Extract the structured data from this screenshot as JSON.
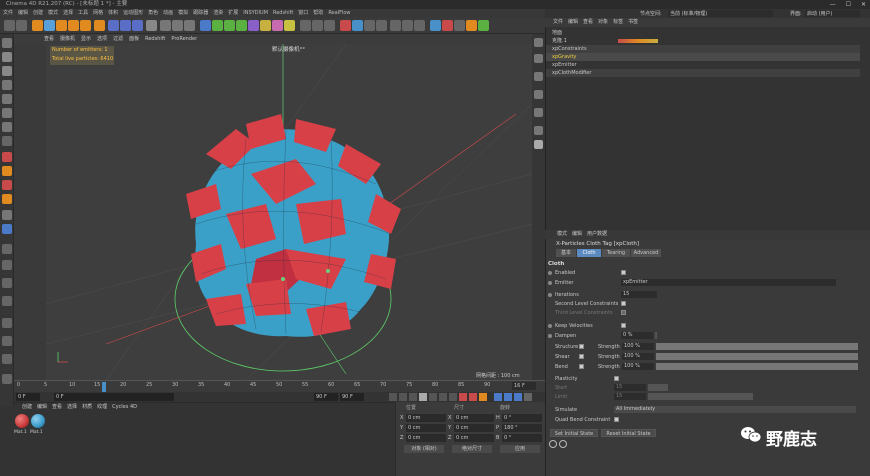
{
  "window": {
    "title": "Cinema 4D R21.207 (RC) - [未标题 1 *] - 主要",
    "controls": [
      "—",
      "☐",
      "✕"
    ]
  },
  "menubar": [
    "文件",
    "编辑",
    "创建",
    "模式",
    "选择",
    "工具",
    "网格",
    "体积",
    "运动图形",
    "角色",
    "动画",
    "模拟",
    "跟踪器",
    "渲染",
    "扩展",
    "INSYDIUM",
    "Redshift",
    "窗口",
    "帮助",
    "RealFlow"
  ],
  "layout_label": "界面:",
  "layout_value": "启动 (用户)",
  "node_space_label": "节点空间:",
  "node_space_value": "当前 (标准/物理)",
  "viewport": {
    "menu": [
      "查看",
      "摄像机",
      "显示",
      "选项",
      "过滤",
      "面板",
      "Redshift",
      "ProRender"
    ],
    "camera_label": "默认摄像机°°",
    "hud": {
      "emitters": "Number of emitters: 1",
      "particles": "Total live particles: 6410"
    },
    "grid_label": "网格间距 : 100 cm"
  },
  "timeline": {
    "ticks": [
      "0",
      "5",
      "10",
      "15",
      "20",
      "25",
      "30",
      "35",
      "40",
      "45",
      "50",
      "55",
      "60",
      "65",
      "70",
      "75",
      "80",
      "85",
      "90"
    ],
    "current_frame": "16 F"
  },
  "playbar": {
    "start": "0 F",
    "current": "0 F",
    "end": "90 F",
    "end2": "90 F"
  },
  "materials": {
    "menu": [
      "创建",
      "编辑",
      "查看",
      "选择",
      "材质",
      "纹理",
      "Cycles 4D"
    ],
    "items": [
      {
        "label": "Mat.1",
        "color": "#c83a3a"
      },
      {
        "label": "Mat.1",
        "color": "#3a9ac8"
      }
    ]
  },
  "coordinates": {
    "headers": [
      "位置",
      "尺寸",
      "旋转"
    ],
    "rows": [
      {
        "axis": "X",
        "pos": "0 cm",
        "size": "0 cm",
        "rot_axis": "H",
        "rot": "0 °"
      },
      {
        "axis": "Y",
        "pos": "0 cm",
        "size": "0 cm",
        "rot_axis": "P",
        "rot": "180 °"
      },
      {
        "axis": "Z",
        "pos": "0 cm",
        "size": "0 cm",
        "rot_axis": "B",
        "rot": "0 °"
      }
    ],
    "mode": "对象 (相对)",
    "size_mode": "绝对尺寸",
    "apply": "应用"
  },
  "object_manager": {
    "menu": [
      "文件",
      "编辑",
      "查看",
      "对象",
      "标签",
      "书签"
    ],
    "objects": [
      {
        "name": "地面",
        "color": "#c8c8c8"
      },
      {
        "name": "克隆.1",
        "color": "#c8c8c8"
      },
      {
        "name": "xpConstraints",
        "color": "#c8c8c8"
      },
      {
        "name": "xpGravity",
        "color": "#f0d040"
      },
      {
        "name": "xpEmitter",
        "color": "#c8c8c8"
      },
      {
        "name": "xpClothModifier",
        "color": "#c8c8c8"
      }
    ]
  },
  "attributes": {
    "menu": [
      "模式",
      "编辑",
      "用户数据"
    ],
    "tag_title": "X-Particles Cloth Tag [xpCloth]",
    "tabs": [
      "基本",
      "Cloth",
      "Tearing",
      "Advanced"
    ],
    "section": "Cloth",
    "enabled": "Enabled",
    "emitter_label": "Emitter",
    "emitter_value": "xpEmitter",
    "iterations_label": "Iterations",
    "iterations_value": "15",
    "second_level": "Second Level Constraints",
    "third_level": "Third Level Constraints",
    "keep_velocities": "Keep Velocities",
    "dampen_label": "Dampen",
    "dampen_value": "0 %",
    "structure": "Structure",
    "shear": "Shear",
    "bend": "Bend",
    "strength_label": "Strength",
    "strength_value": "100 %",
    "plasticity": "Plasticity",
    "start_label": "Start",
    "start_value": "15",
    "limit_label": "Limit",
    "limit_value": "15",
    "simulate_label": "Simulate",
    "simulate_value": "All Immediately",
    "quad_bend": "Quad Bend Constraint",
    "set_initial": "Set Initial State",
    "reset_initial": "Reset Initial State"
  },
  "watermark": "野鹿志"
}
